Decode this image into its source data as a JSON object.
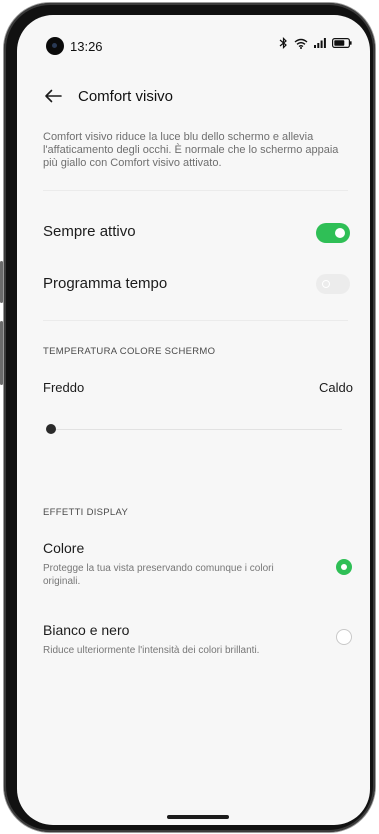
{
  "status_bar": {
    "time": "13:26",
    "icons": [
      "camera-icon",
      "bluetooth-icon",
      "wifi-icon",
      "signal-icon",
      "battery-icon"
    ]
  },
  "header": {
    "back_icon": "arrow-left-icon",
    "title": "Comfort visivo"
  },
  "description": "Comfort visivo riduce la luce blu dello schermo e allevia l'affaticamento degli occhi. È normale che lo schermo appaia più giallo con Comfort visivo attivato.",
  "settings": {
    "always_on": {
      "label": "Sempre attivo",
      "state": "on"
    },
    "schedule": {
      "label": "Programma tempo",
      "state": "off"
    }
  },
  "temperature": {
    "section_title": "TEMPERATURA COLORE SCHERMO",
    "min_label": "Freddo",
    "max_label": "Caldo",
    "value_fraction": 0.0
  },
  "effects": {
    "section_title": "EFFETTI DISPLAY",
    "options": [
      {
        "title": "Colore",
        "description": "Protegge la tua vista preservando comunque i colori originali.",
        "selected": true
      },
      {
        "title": "Bianco e nero",
        "description": "Riduce ulteriormente l'intensità dei colori brillanti.",
        "selected": false
      }
    ]
  },
  "colors": {
    "accent_green": "#2fbf56",
    "background": "#f7f7f7",
    "text_primary": "#1c1c1c",
    "text_secondary": "#6f6f6f"
  }
}
